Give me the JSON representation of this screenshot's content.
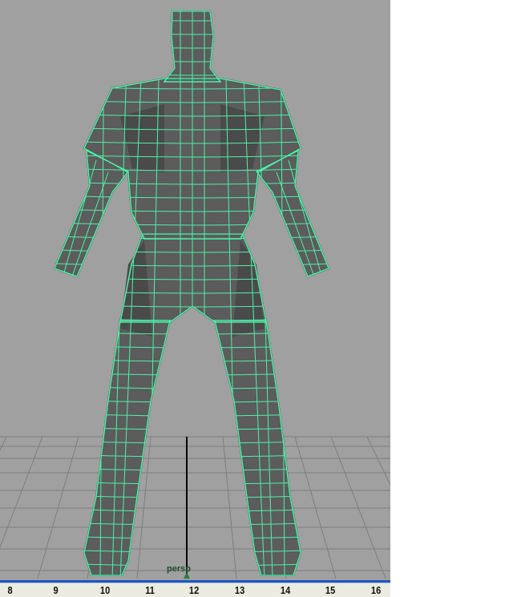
{
  "viewport": {
    "camera_label": "persp",
    "colors": {
      "background": "#a0a0a0",
      "grid": "#7e7e7e",
      "mesh": "#5c5c5c",
      "mesh_dark": "#333",
      "wire": "#4ff0a8",
      "axis": "#000000"
    }
  },
  "timeline": {
    "ticks": [
      "8",
      "9",
      "10",
      "11",
      "12",
      "13",
      "14",
      "15",
      "16"
    ],
    "accent": "#1f57c0"
  }
}
